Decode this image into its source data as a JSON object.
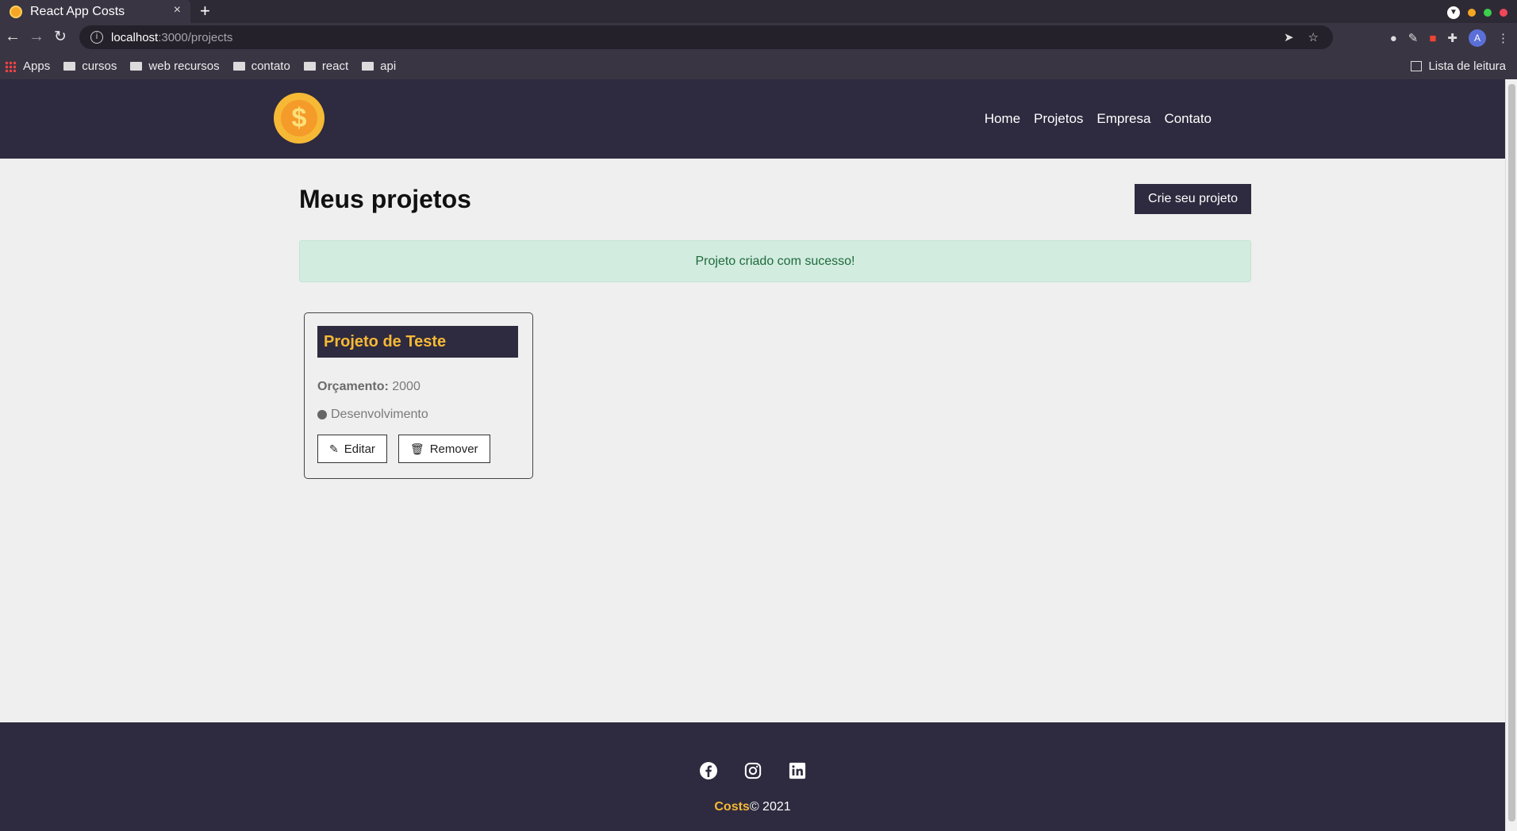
{
  "browser": {
    "tab_title": "React App Costs",
    "tab_close": "×",
    "new_tab": "+",
    "url_host": "localhost",
    "url_path": ":3000/projects",
    "bookmarks": [
      "Apps",
      "cursos",
      "web recursos",
      "contato",
      "react",
      "api"
    ],
    "reading_list": "Lista de leitura",
    "avatar_letter": "A"
  },
  "navbar": {
    "logo_symbol": "$",
    "links": [
      "Home",
      "Projetos",
      "Empresa",
      "Contato"
    ]
  },
  "main": {
    "title": "Meus projetos",
    "create_button": "Crie seu projeto",
    "alert": "Projeto criado com sucesso!"
  },
  "projects": [
    {
      "name": "Projeto de Teste",
      "budget_label": "Orçamento:",
      "budget_value": "2000",
      "category": "Desenvolvimento",
      "edit_label": "Editar",
      "remove_label": "Remover"
    }
  ],
  "footer": {
    "brand": "Costs",
    "copyright": "© 2021",
    "socials": [
      "facebook-icon",
      "instagram-icon",
      "linkedin-icon"
    ]
  },
  "colors": {
    "navbar": "#2e2a3f",
    "accent": "#f6b936",
    "alert_bg": "#d2ece0",
    "alert_text": "#1f6b3b"
  }
}
